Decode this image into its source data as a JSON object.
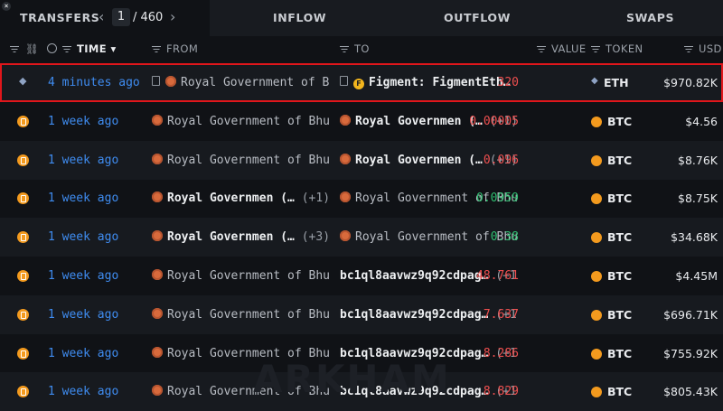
{
  "tabs": {
    "transfers": "TRANSFERS",
    "page_current": "1",
    "page_total": "/ 460",
    "inflow": "INFLOW",
    "outflow": "OUTFLOW",
    "swaps": "SWAPS"
  },
  "header": {
    "time": "TIME",
    "from": "FROM",
    "to": "TO",
    "value": "VALUE",
    "token": "TOKEN",
    "usd": "USD"
  },
  "watermark": "ARKHAM",
  "colors": {
    "selected_outline": "#e0161b",
    "link": "#3f8cf0",
    "negative": "#ef4f4f",
    "positive": "#2fbf71"
  },
  "rows": [
    {
      "chain": "eth-icon",
      "time": "4 minutes ago",
      "from_icon": "doc",
      "from": "Royal Government of B",
      "from_bold": false,
      "from_plus": "",
      "to_icon": "figment",
      "to": "Figment: FigmentEth…",
      "to_bold": true,
      "to_plus": "",
      "value": "320",
      "value_color": "red",
      "token": "ETH",
      "usd": "$970.82K"
    },
    {
      "chain": "btc-icon",
      "time": "1 week ago",
      "from": "Royal Government of Bhu",
      "from_bold": false,
      "from_plus": "",
      "to_icon": "entity",
      "to": "Royal Governmen (…",
      "to_bold": true,
      "to_plus": "(+1)",
      "value": "0.00005",
      "value_color": "red",
      "token": "BTC",
      "usd": "$4.56"
    },
    {
      "chain": "btc-icon",
      "time": "1 week ago",
      "from": "Royal Government of Bhu",
      "from_bold": false,
      "from_plus": "",
      "to_icon": "entity",
      "to": "Royal Governmen (…",
      "to_bold": true,
      "to_plus": "(+1)",
      "value": "0.096",
      "value_color": "red",
      "token": "BTC",
      "usd": "$8.76K"
    },
    {
      "chain": "btc-icon",
      "time": "1 week ago",
      "from": "Royal Governmen (…",
      "from_bold": true,
      "from_plus": "(+1)",
      "to_icon": "entity",
      "to": "Royal Government of Bhu",
      "to_bold": false,
      "to_plus": "",
      "value": "0.0959",
      "value_color": "green",
      "token": "BTC",
      "usd": "$8.75K"
    },
    {
      "chain": "btc-icon",
      "time": "1 week ago",
      "from": "Royal Governmen (…",
      "from_bold": true,
      "from_plus": "(+3)",
      "to_icon": "entity",
      "to": "Royal Government of Bhu",
      "to_bold": false,
      "to_plus": "",
      "value": "0.38",
      "value_color": "green",
      "token": "BTC",
      "usd": "$34.68K"
    },
    {
      "chain": "btc-icon",
      "time": "1 week ago",
      "from": "Royal Government of Bhu",
      "from_bold": false,
      "from_plus": "",
      "to_icon": "none",
      "to": "bc1ql8aavwz9q92cdpag…",
      "to_bold": true,
      "to_plus": "(+1)",
      "value": "48.761",
      "value_color": "red",
      "token": "BTC",
      "usd": "$4.45M"
    },
    {
      "chain": "btc-icon",
      "time": "1 week ago",
      "from": "Royal Government of Bhu",
      "from_bold": false,
      "from_plus": "",
      "to_icon": "none",
      "to": "bc1ql8aavwz9q92cdpag…",
      "to_bold": true,
      "to_plus": "(+1)",
      "value": "7.637",
      "value_color": "red",
      "token": "BTC",
      "usd": "$696.71K"
    },
    {
      "chain": "btc-icon",
      "time": "1 week ago",
      "from": "Royal Government of Bhu",
      "from_bold": false,
      "from_plus": "",
      "to_icon": "none",
      "to": "bc1ql8aavwz9q92cdpag…",
      "to_bold": true,
      "to_plus": "(+1)",
      "value": "8.286",
      "value_color": "red",
      "token": "BTC",
      "usd": "$755.92K"
    },
    {
      "chain": "btc-icon",
      "time": "1 week ago",
      "from": "Royal Government of Bhu",
      "from_bold": false,
      "from_plus": "",
      "to_icon": "none",
      "to": "bc1ql8aavwz9q92cdpag…",
      "to_bold": true,
      "to_plus": "(+1)",
      "value": "8.829",
      "value_color": "red",
      "token": "BTC",
      "usd": "$805.43K"
    }
  ]
}
